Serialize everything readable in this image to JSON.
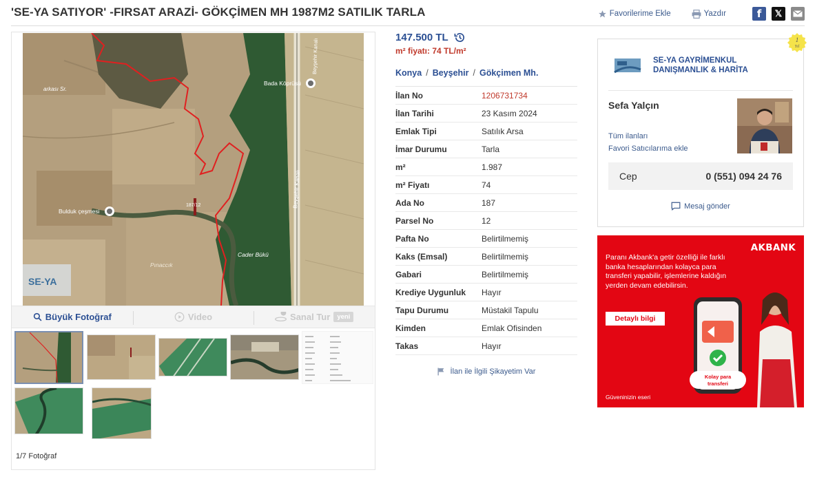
{
  "header": {
    "title": "'SE-YA SATIYOR' -FIRSAT ARAZİ- GÖKÇİMEN MH 1987M2 SATILIK TARLA",
    "favorites_label": "Favorilerime Ekle",
    "print_label": "Yazdır",
    "share_icons": [
      "facebook-icon",
      "x-icon",
      "mail-icon"
    ]
  },
  "gallery": {
    "map_labels": {
      "village": "Bulduk çeşmesi",
      "bridge": "Bada Köprüsü",
      "canal": "Beyşehir Kanalı",
      "canal2": "Beyşehir Kanalı",
      "area": "Cader Bükü",
      "parcel": "187/12",
      "pinar": "Pınaccık",
      "west": "arkası Sr.",
      "watermark": "SE-YA"
    },
    "tabs": [
      {
        "label": "Büyük Fotoğraf",
        "icon": "search-icon"
      },
      {
        "label": "Video",
        "icon": "play-icon"
      },
      {
        "label": "Sanal Tur",
        "icon": "virtual-tour-icon",
        "badge": "yeni"
      }
    ],
    "counter": "1/7 Fotoğraf"
  },
  "listing": {
    "price": "147.500 TL",
    "m2_price": "m² fiyatı: 74 TL/m²",
    "location": [
      "Konya",
      "Beyşehir",
      "Gökçimen Mh."
    ],
    "location_sep": "/",
    "rows": [
      {
        "k": "İlan No",
        "v": "1206731734"
      },
      {
        "k": "İlan Tarihi",
        "v": "23 Kasım 2024"
      },
      {
        "k": "Emlak Tipi",
        "v": "Satılık Arsa"
      },
      {
        "k": "İmar Durumu",
        "v": "Tarla"
      },
      {
        "k": "m²",
        "v": "1.987"
      },
      {
        "k": "m² Fiyatı",
        "v": "74"
      },
      {
        "k": "Ada No",
        "v": "187"
      },
      {
        "k": "Parsel No",
        "v": "12"
      },
      {
        "k": "Pafta No",
        "v": "Belirtilmemiş"
      },
      {
        "k": "Kaks (Emsal)",
        "v": "Belirtilmemiş"
      },
      {
        "k": "Gabari",
        "v": "Belirtilmemiş"
      },
      {
        "k": "Krediye Uygunluk",
        "v": "Hayır"
      },
      {
        "k": "Tapu Durumu",
        "v": "Müstakil Tapulu"
      },
      {
        "k": "Kimden",
        "v": "Emlak Ofisinden"
      },
      {
        "k": "Takas",
        "v": "Hayır"
      }
    ],
    "complaint_label": "İlan ile İlgili Şikayetim Var"
  },
  "seller": {
    "badge": "1 Yıl",
    "badge_num": "1",
    "badge_unit": "Yıl",
    "agency_line1": "SE-YA GAYRİMENKUL",
    "agency_line2": "DANIŞMANLIK & HARİTA",
    "name": "Sefa Yalçın",
    "all_listings": "Tüm ilanları",
    "add_favorite_seller": "Favori Satıcılarıma ekle",
    "phone_label": "Cep",
    "phone": "0 (551) 094 24 76",
    "message_label": "Mesaj gönder"
  },
  "ad": {
    "brand": "AKBANK",
    "text": "Paranı Akbank'a getir özelliği ile farklı banka hesaplarından kolayca para transferi yapabilir, işlemlerine kaldığın yerden devam edebilirsin.",
    "button": "Detaylı bilgi",
    "phone_caption_1": "Kolay para",
    "phone_caption_2": "transferi",
    "footer": "Güveninizin eseri"
  },
  "colors": {
    "link": "#2b4f93",
    "price_red": "#c0392b",
    "ad_red": "#e30613"
  }
}
